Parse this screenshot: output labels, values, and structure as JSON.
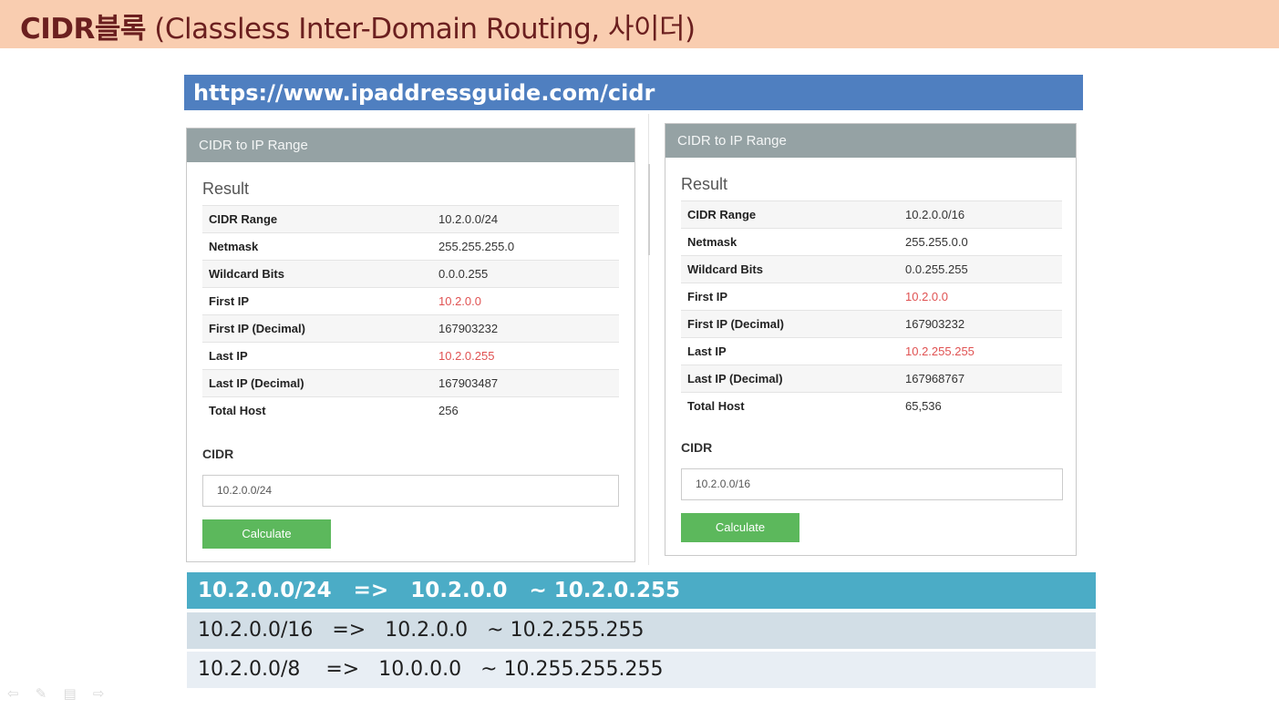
{
  "title": {
    "bold": "CIDR블록",
    "rest": " (Classless Inter-Domain Routing, 사이더)"
  },
  "url": "https://www.ipaddressguide.com/cidr",
  "left_panel": {
    "header": "CIDR to IP Range",
    "result_title": "Result",
    "rows": [
      {
        "label": "CIDR Range",
        "value": "10.2.0.0/24"
      },
      {
        "label": "Netmask",
        "value": "255.255.255.0"
      },
      {
        "label": "Wildcard Bits",
        "value": "0.0.0.255"
      },
      {
        "label": "First IP",
        "value": "10.2.0.0"
      },
      {
        "label": "First IP (Decimal)",
        "value": "167903232"
      },
      {
        "label": "Last IP",
        "value": "10.2.0.255"
      },
      {
        "label": "Last IP (Decimal)",
        "value": "167903487"
      },
      {
        "label": "Total Host",
        "value": "256"
      }
    ],
    "cidr_label": "CIDR",
    "cidr_value": "10.2.0.0/24",
    "button": "Calculate"
  },
  "right_panel": {
    "header": "CIDR to IP Range",
    "result_title": "Result",
    "rows": [
      {
        "label": "CIDR Range",
        "value": "10.2.0.0/16"
      },
      {
        "label": "Netmask",
        "value": "255.255.0.0"
      },
      {
        "label": "Wildcard Bits",
        "value": "0.0.255.255"
      },
      {
        "label": "First IP",
        "value": "10.2.0.0"
      },
      {
        "label": "First IP (Decimal)",
        "value": "167903232"
      },
      {
        "label": "Last IP",
        "value": "10.2.255.255"
      },
      {
        "label": "Last IP (Decimal)",
        "value": "167968767"
      },
      {
        "label": "Total Host",
        "value": "65,536"
      }
    ],
    "cidr_label": "CIDR",
    "cidr_value": "10.2.0.0/16",
    "button": "Calculate"
  },
  "results": [
    "10.2.0.0/24   =>   10.2.0.0   ~ 10.2.0.255",
    "10.2.0.0/16   =>   10.2.0.0   ~ 10.2.255.255",
    "10.2.0.0/8    =>   10.0.0.0   ~ 10.255.255.255"
  ],
  "colors": {
    "title_bg": "#f9cdb0",
    "url_bg": "#4f7fc0",
    "panel_header_bg": "#95a2a4",
    "button_bg": "#5cb85c",
    "highlight_ip": "#e05252",
    "result_row1_bg": "#4bacc6"
  },
  "nav_icons": [
    "arrow-left-icon",
    "pen-icon",
    "menu-icon",
    "arrow-right-icon"
  ]
}
